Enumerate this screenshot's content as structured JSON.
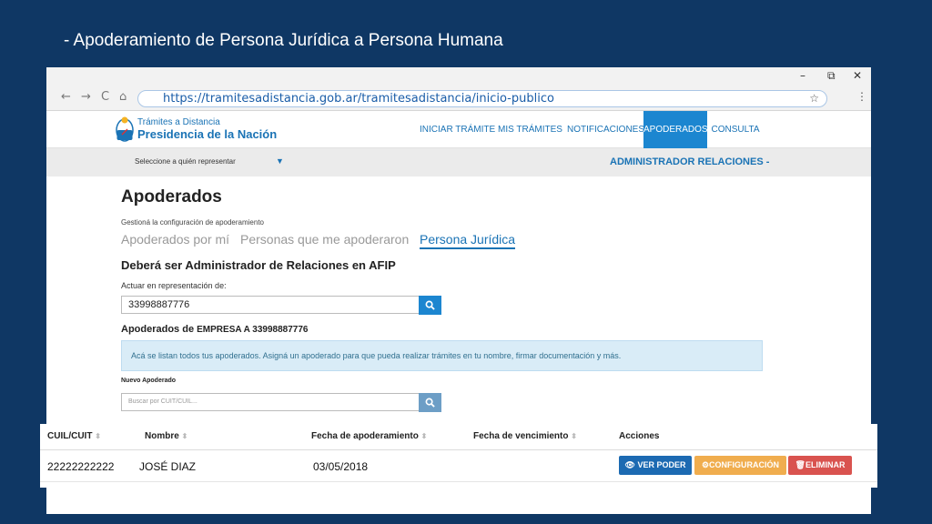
{
  "slide": {
    "title": "- Apoderamiento de Persona Jurídica a Persona Humana"
  },
  "browser": {
    "url": "https://tramitesadistancia.gob.ar/tramitesadistancia/inicio-publico",
    "icons": {
      "back": "←",
      "forward": "→",
      "reload": "C",
      "home": "⌂",
      "star": "☆",
      "menu": "⋮",
      "minimize": "–",
      "restore": "⧉",
      "close": "✕"
    }
  },
  "header": {
    "brand_small": "Trámites a Distancia",
    "brand_big": "Presidencia de la Nación",
    "menu": [
      "INICIAR TRÁMITE",
      "MIS TRÁMITES",
      "NOTIFICACIONES",
      "APODERADOS",
      "CONSULTA"
    ],
    "active_menu": "APODERADOS"
  },
  "representation": {
    "select_label": "Seleccione a quién representar",
    "caret": "▼",
    "admin_menu": "ADMINISTRADOR RELACIONES -"
  },
  "main": {
    "title": "Apoderados",
    "subtitle": "Gestioná la configuración de apoderamiento",
    "tabs": [
      "Apoderados por mí",
      "Personas que me apoderaron",
      "Persona Jurídica"
    ],
    "active_tab": "Persona Jurídica",
    "warning": "Deberá ser Administrador de Relaciones en AFIP",
    "act_label": "Actuar en representación de:",
    "cuit_value": "33998887776",
    "apoderados_prefix": "Apoderados de",
    "company": "EMPRESA A   33998887776",
    "info": "Acá se listan todos tus apoderados. Asigná un apoderado para que pueda realizar trámites en tu nombre, firmar documentación y más.",
    "nuevo_label": "Nuevo Apoderado",
    "search_placeholder": "Buscar por CUIT/CUIL..."
  },
  "table": {
    "columns": [
      "CUIL/CUIT",
      "Nombre",
      "Fecha de apoderamiento",
      "Fecha de vencimiento",
      "Acciones"
    ],
    "rows": [
      {
        "cuil": "22222222222",
        "nombre": "JOSÉ DIAZ",
        "fecha_apod": "03/05/2018",
        "fecha_venc": ""
      }
    ],
    "actions": {
      "ver": "VER PODER",
      "config": "CONFIGURACIÓN",
      "eliminar": "ELIMINAR"
    }
  },
  "colors": {
    "slide_bg": "#0f3764",
    "primary": "#1c86d0",
    "warning": "#f0ad4e",
    "danger": "#d9534f",
    "info_bg": "#d9ecf7"
  }
}
